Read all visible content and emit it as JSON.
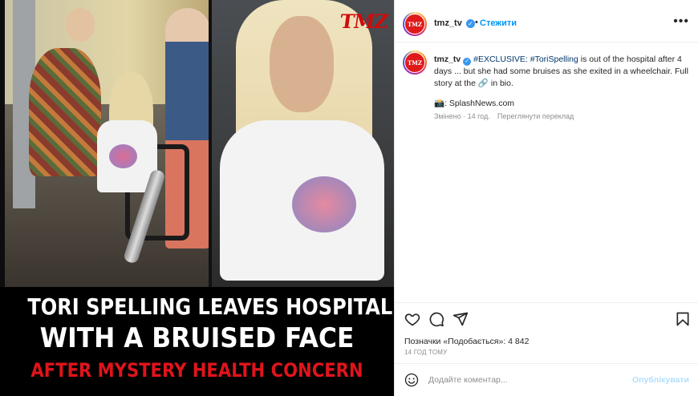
{
  "media": {
    "tmz_logo": "TMZ",
    "headline_line1": "TORI SPELLING LEAVES HOSPITAL",
    "headline_line2": "WITH A BRUISED FACE",
    "headline_line3": "AFTER MYSTERY HEALTH CONCERN",
    "colors": {
      "logo_red": "#d10a0a",
      "headline_red": "#e0141b"
    }
  },
  "post": {
    "header": {
      "avatar_label": "TMZ",
      "username": "tmz_tv",
      "verified_icon": "verified-badge-icon",
      "separator": "•",
      "follow_label": "Стежити",
      "more_icon": "•••"
    },
    "caption": {
      "username": "tmz_tv",
      "tag1": "#EXCLUSIVE:",
      "tag2": "#ToriSpelling",
      "text": " is out of the hospital after 4 days ... but she had some bruises as she exited in a wheelchair. Full story at the ",
      "link_emoji": "🔗",
      "text_end": " in bio.",
      "credit_icon": "📸",
      "credit": ": SplashNews.com",
      "meta": "Змінено · 14 год.",
      "translate": "Переглянути переклад"
    },
    "actions": {
      "like_icon": "heart-icon",
      "comment_icon": "comment-icon",
      "share_icon": "send-icon",
      "save_icon": "bookmark-icon"
    },
    "likes_text": "Позначки «Подобається»: 4 842",
    "date": "14 ГОД ТОМУ",
    "comment": {
      "placeholder": "Додайте коментар...",
      "publish_label": "Опублікувати"
    },
    "colors": {
      "link": "#0095f6",
      "muted": "#8e8e8e",
      "hashtag": "#00376b"
    }
  }
}
